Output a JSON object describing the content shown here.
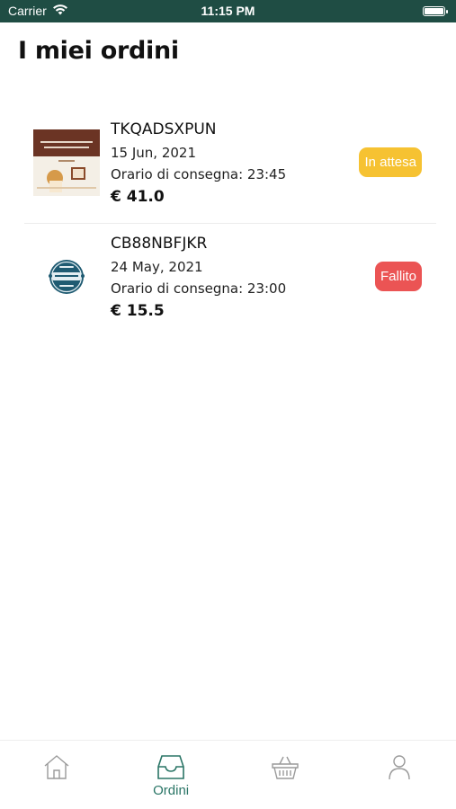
{
  "status_bar": {
    "carrier": "Carrier",
    "time": "11:15 PM"
  },
  "page": {
    "title": "I miei ordini"
  },
  "orders": [
    {
      "code": "TKQADSXPUN",
      "date": "15 Jun, 2021",
      "delivery_time": "Orario di consegna: 23:45",
      "price": "€ 41.0",
      "status": "In attesa",
      "status_color": "#f6c232"
    },
    {
      "code": "CB88NBFJKR",
      "date": "24 May, 2021",
      "delivery_time": "Orario di consegna: 23:00",
      "price": "€ 15.5",
      "status": "Fallito",
      "status_color": "#eb5454"
    }
  ],
  "tab_bar": {
    "tabs": [
      {
        "icon": "home-icon",
        "label": ""
      },
      {
        "icon": "inbox-icon",
        "label": "Ordini",
        "active": true
      },
      {
        "icon": "basket-icon",
        "label": ""
      },
      {
        "icon": "profile-icon",
        "label": ""
      }
    ],
    "active_color": "#2a7566",
    "inactive_color": "#9a9a9a"
  }
}
